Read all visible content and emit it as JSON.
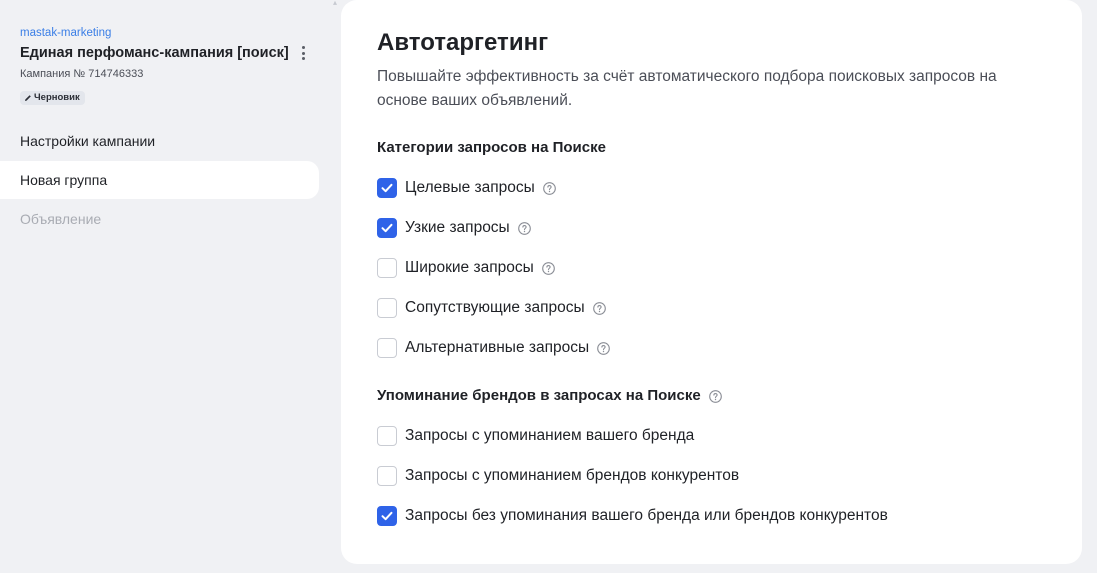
{
  "sidebar": {
    "account": "mastak-marketing",
    "campaign_title": "Единая перфоманс-кампания [поиск]",
    "campaign_number": "Кампания № 714746333",
    "status": "Черновик",
    "nav": [
      {
        "label": "Настройки кампании",
        "state": "normal"
      },
      {
        "label": "Новая группа",
        "state": "active"
      },
      {
        "label": "Объявление",
        "state": "disabled"
      }
    ]
  },
  "main": {
    "title": "Автотаргетинг",
    "description": "Повышайте эффективность за счёт автоматического подбора поисковых запросов на основе ваших объявлений.",
    "categories": {
      "title": "Категории запросов на Поиске",
      "items": [
        {
          "label": "Целевые запросы",
          "checked": true,
          "help": true
        },
        {
          "label": "Узкие запросы",
          "checked": true,
          "help": true
        },
        {
          "label": "Широкие запросы",
          "checked": false,
          "help": true
        },
        {
          "label": "Сопутствующие запросы",
          "checked": false,
          "help": true
        },
        {
          "label": "Альтернативные запросы",
          "checked": false,
          "help": true
        }
      ]
    },
    "brands": {
      "title": "Упоминание брендов в запросах на Поиске",
      "items": [
        {
          "label": "Запросы с упоминанием вашего бренда",
          "checked": false
        },
        {
          "label": "Запросы с упоминанием брендов конкурентов",
          "checked": false
        },
        {
          "label": "Запросы без упоминания вашего бренда или брендов конкурентов",
          "checked": true
        }
      ]
    }
  },
  "colors": {
    "accent": "#2f63e8",
    "link": "#3a7ee6",
    "background": "#f0f1f4"
  }
}
